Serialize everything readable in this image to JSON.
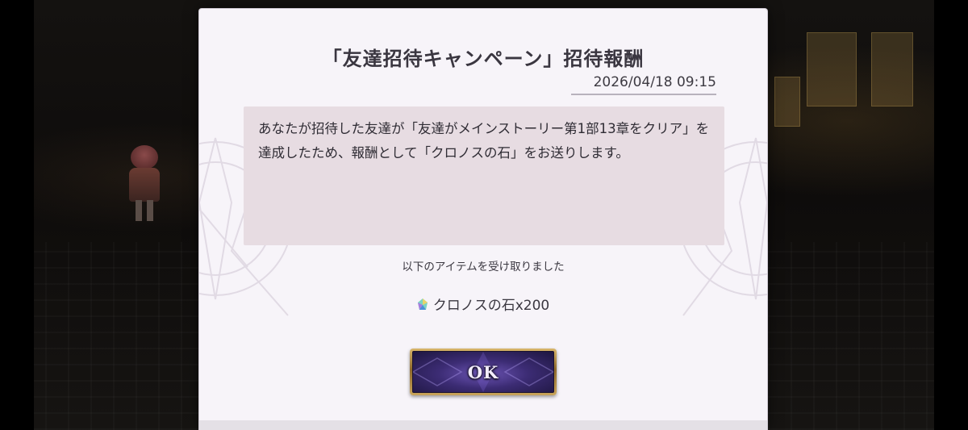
{
  "dialog": {
    "title": "「友達招待キャンペーン」招待報酬",
    "date": "2026/04/18 09:15",
    "message": "あなたが招待した友達が「友達がメインストーリー第1部13章をクリア」を達成したため、報酬として「クロノスの石」をお送りします。",
    "received_label": "以下のアイテムを受け取りました",
    "item": {
      "icon": "chronos-stone-icon",
      "label": "クロノスの石x200"
    },
    "ok_label": "OK"
  },
  "colors": {
    "dialog_bg": "#f7f4f9",
    "message_bg": "#e7dce2",
    "button_purple": "#3c2c74",
    "button_gold": "#c9a45a"
  }
}
